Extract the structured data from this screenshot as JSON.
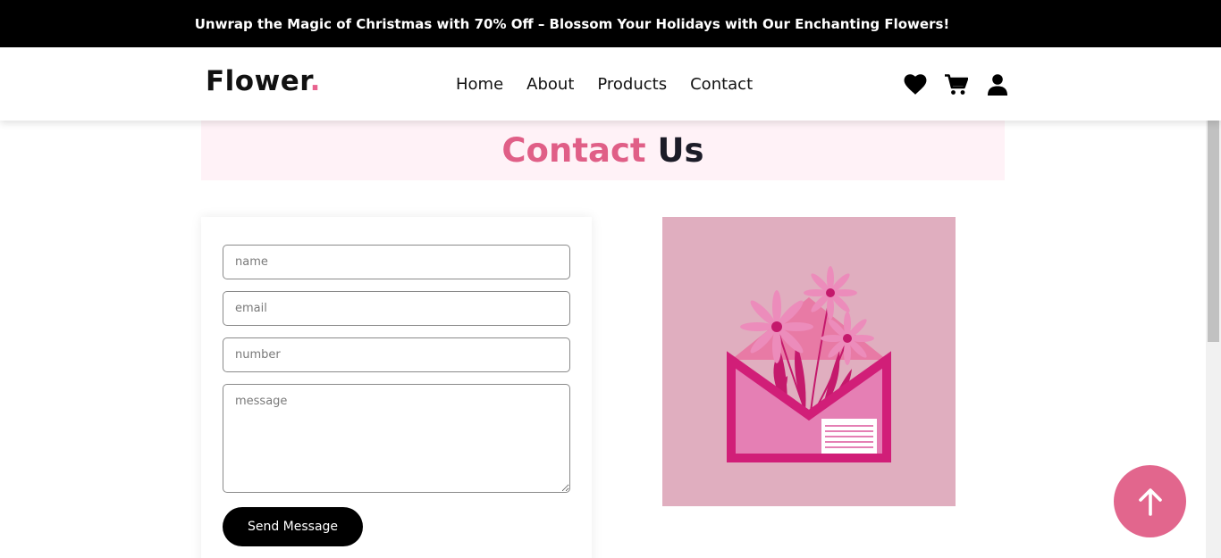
{
  "announcement": "Unwrap the Magic of Christmas with 70% Off – Blossom Your Holidays with Our Enchanting Flowers!",
  "header": {
    "logo_text": "Flower",
    "logo_dot": ".",
    "nav": [
      "Home",
      "About",
      "Products",
      "Contact"
    ],
    "icons": [
      "heart-icon",
      "cart-icon",
      "user-icon"
    ]
  },
  "heading": {
    "part1": "Contact",
    "part2": "Us"
  },
  "form": {
    "name_placeholder": "name",
    "email_placeholder": "email",
    "number_placeholder": "number",
    "message_placeholder": "message",
    "submit_label": "Send Message"
  },
  "scroll_top_icon": "arrow-up-icon",
  "colors": {
    "accent": "#e05f87",
    "announcement_bg": "#000000",
    "heading_band_bg": "#fff2f7",
    "illustration_bg": "#e0aebf"
  }
}
